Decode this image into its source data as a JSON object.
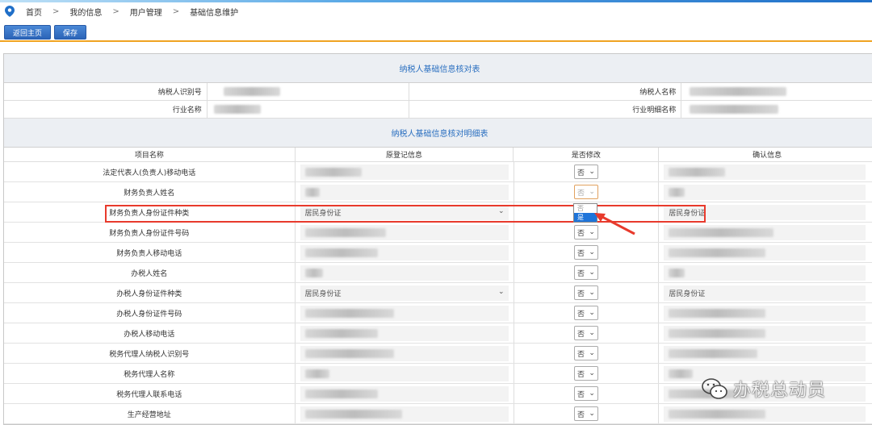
{
  "breadcrumb": [
    "首页",
    "我的信息",
    "用户管理",
    "基础信息维护"
  ],
  "breadcrumb_sep": ">",
  "toolbar": {
    "home_label": "返回主页",
    "save_label": "保存"
  },
  "panel": {
    "title": "纳税人基础信息核对表",
    "taxpayer_id_label": "纳税人识别号",
    "taxpayer_name_label": "纳税人名称",
    "industry_label": "行业名称",
    "industry_detail_label": "行业明细名称",
    "detail_title": "纳税人基础信息核对明细表"
  },
  "columns": [
    "项目名称",
    "原登记信息",
    "是否修改",
    "确认信息"
  ],
  "rows": [
    {
      "name": "法定代表人(负责人)移动电话",
      "original": "",
      "modify": "否",
      "confirm": ""
    },
    {
      "name": "财务负责人姓名",
      "original": "",
      "modify": "否",
      "confirm": ""
    },
    {
      "name": "财务负责人身份证件种类",
      "original": "居民身份证",
      "modify": "是",
      "confirm": "居民身份证"
    },
    {
      "name": "财务负责人身份证件号码",
      "original": "",
      "modify": "否",
      "confirm": ""
    },
    {
      "name": "财务负责人移动电话",
      "original": "",
      "modify": "否",
      "confirm": ""
    },
    {
      "name": "办税人姓名",
      "original": "",
      "modify": "否",
      "confirm": ""
    },
    {
      "name": "办税人身份证件种类",
      "original": "居民身份证",
      "modify": "否",
      "confirm": "居民身份证"
    },
    {
      "name": "办税人身份证件号码",
      "original": "",
      "modify": "否",
      "confirm": ""
    },
    {
      "name": "办税人移动电话",
      "original": "",
      "modify": "否",
      "confirm": ""
    },
    {
      "name": "税务代理人纳税人识别号",
      "original": "",
      "modify": "否",
      "confirm": ""
    },
    {
      "name": "税务代理人名称",
      "original": "",
      "modify": "否",
      "confirm": ""
    },
    {
      "name": "税务代理人联系电话",
      "original": "",
      "modify": "否",
      "confirm": ""
    },
    {
      "name": "生产经营地址",
      "original": "",
      "modify": "否",
      "confirm": ""
    }
  ],
  "dropdown": {
    "options": [
      "否",
      "是"
    ],
    "selected": "是"
  },
  "watermark": {
    "text": "办税总动员"
  },
  "colors": {
    "accent": "#2a6fc0",
    "button": "#2b64b8",
    "highlight": "#e83a2c",
    "divider": "#f0a322"
  }
}
